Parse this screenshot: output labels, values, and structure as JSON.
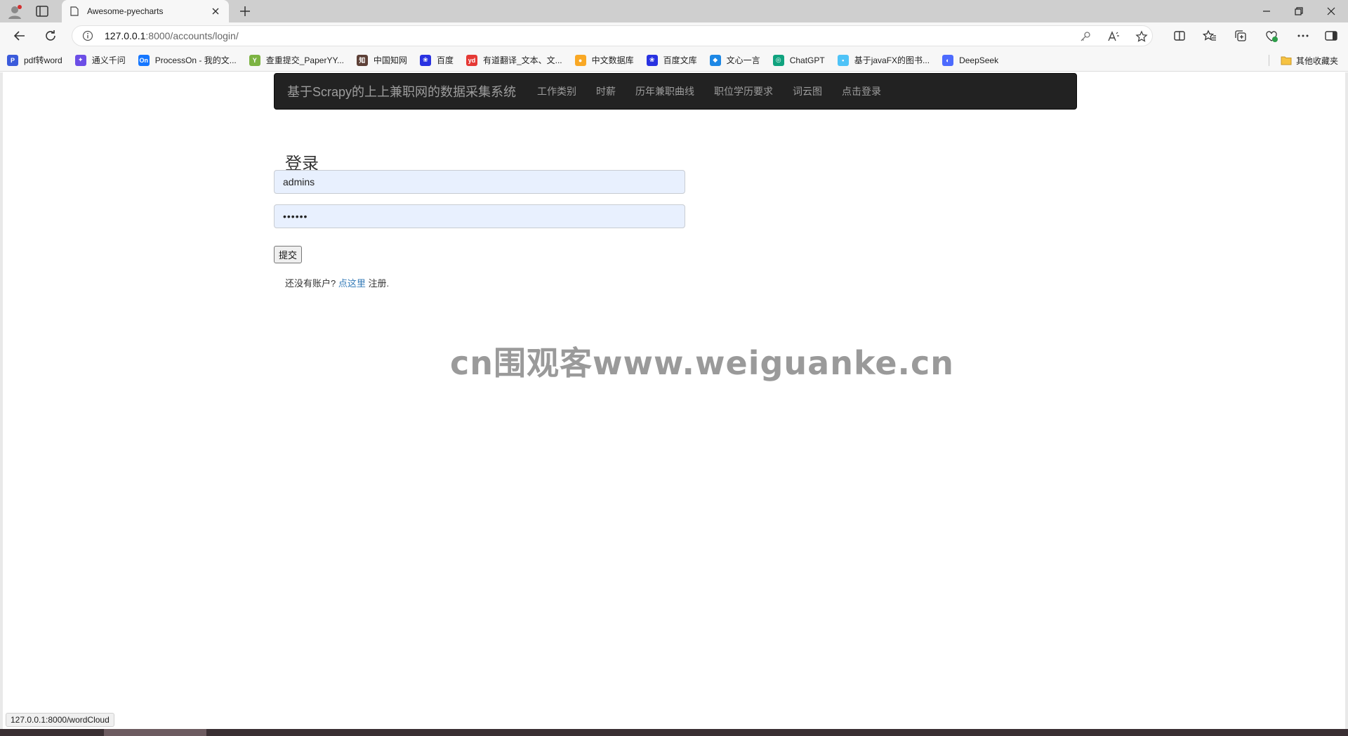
{
  "browser": {
    "tab_title": "Awesome-pyecharts",
    "url_host": "127.0.0.1",
    "url_path": ":8000/accounts/login/",
    "bookmarks": [
      {
        "label": "pdf转word",
        "icon": "pdf-icon",
        "color": "#3b5bdb",
        "glyph": "P"
      },
      {
        "label": "通义千问",
        "icon": "tongyi-icon",
        "color": "#6c4ee6",
        "glyph": "✦"
      },
      {
        "label": "ProcessOn - 我的文...",
        "icon": "processon-icon",
        "color": "#1677ff",
        "glyph": "On"
      },
      {
        "label": "查重提交_PaperYY...",
        "icon": "paperyy-icon",
        "color": "#7cb342",
        "glyph": "Y"
      },
      {
        "label": "中国知网",
        "icon": "cnki-icon",
        "color": "#5d4037",
        "glyph": "知"
      },
      {
        "label": "百度",
        "icon": "baidu-icon",
        "color": "#2932e1",
        "glyph": "❀"
      },
      {
        "label": "有道翻译_文本、文...",
        "icon": "youdao-icon",
        "color": "#e53935",
        "glyph": "yd"
      },
      {
        "label": "中文数据库",
        "icon": "location-icon",
        "color": "#f9a825",
        "glyph": "●"
      },
      {
        "label": "百度文库",
        "icon": "baidu-wenku-icon",
        "color": "#2932e1",
        "glyph": "❀"
      },
      {
        "label": "文心一言",
        "icon": "wenxin-icon",
        "color": "#1e88e5",
        "glyph": "◆"
      },
      {
        "label": "ChatGPT",
        "icon": "chatgpt-icon",
        "color": "#10a37f",
        "glyph": "◎"
      },
      {
        "label": "基于javaFX的图书...",
        "icon": "page-icon",
        "color": "#4fc3f7",
        "glyph": "▪"
      },
      {
        "label": "DeepSeek",
        "icon": "deepseek-icon",
        "color": "#4d6bfe",
        "glyph": "◐"
      }
    ],
    "other_bookmarks": "其他收藏夹",
    "status_url": "127.0.0.1:8000/wordCloud"
  },
  "navbar": {
    "brand": "基于Scrapy的上上兼职网的数据采集系统",
    "links": [
      "工作类别",
      "时薪",
      "历年兼职曲线",
      "职位学历要求",
      "词云图",
      "点击登录"
    ]
  },
  "login": {
    "title": "登录",
    "username_value": "admins",
    "password_value": "••••••",
    "submit_label": "提交",
    "register_prefix": "还没有账户?",
    "register_link": "点这里",
    "register_suffix": "注册."
  },
  "watermark": "cn围观客www.weiguanke.cn"
}
